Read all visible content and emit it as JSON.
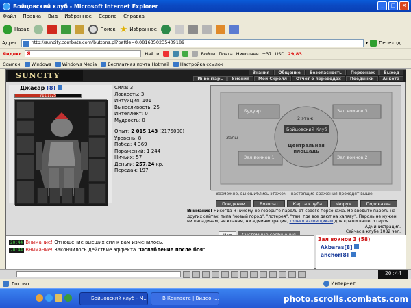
{
  "window": {
    "title": "Бойцовский клуб - Microsoft Internet Explorer"
  },
  "menu": [
    "Файл",
    "Правка",
    "Вид",
    "Избранное",
    "Сервис",
    "Справка"
  ],
  "toolbar": {
    "back": "Назад",
    "search": "Поиск",
    "favorites": "Избранное"
  },
  "address": {
    "label": "Адрес:",
    "url": "http://suncity.combats.com/buttons.pl?battle=0.0816350235409189",
    "go": "Переход"
  },
  "yandex": {
    "brand": "Яндекс",
    "query": "Я",
    "find": "Найти",
    "login": "Войти",
    "mail": "Почта",
    "user": "Николаев",
    "temp": "+37",
    "currency": "USD",
    "rate": "29,83"
  },
  "links": {
    "label": "Ссылки",
    "items": [
      "Windows",
      "Windows Media",
      "Бесплатная почта Hotmail",
      "Настройка ссылок"
    ]
  },
  "game": {
    "logo": "SUNCITY",
    "nav_top": [
      "Знания",
      "Общение",
      "Безопасность",
      "Персонаж",
      "Выход"
    ],
    "nav_bottom": [
      "Инвентарь",
      "Умения",
      "Мой Скролл",
      "Отчет о переводах",
      "Поединки",
      "Анкета"
    ],
    "character": {
      "name": "Джасар",
      "level": "[8]",
      "hp": "711/1125",
      "hp_fraction": 0.63
    },
    "stats": [
      "Сила: 3",
      "Ловкость: 3",
      "Интуиция: 101",
      "Выносливость: 25",
      "Интеллект: 0",
      "Мудрость: 0"
    ],
    "exp_label": "Опыт:",
    "exp_value": "2 015 143",
    "exp_next": "(2175000)",
    "details": [
      "Уровень: 8",
      "Побед: 4 369",
      "Поражений: 1 244",
      "Ничьих: 57"
    ],
    "money_label": "Деньги:",
    "money_value": "257.24",
    "money_unit": "кр.",
    "transfers": "Передач: 197",
    "map_labels": [
      "Будуар",
      "2 этаж",
      "Зал воинов 3",
      "Бойцовский Клуб",
      "Залы",
      "Центральная площадь",
      "Зал воинов 1",
      "Зал воинов 2"
    ],
    "map_note": "Возможно, вы ошиблись этажом - настоящие сражения проходят выше.",
    "map_buttons": [
      "Поединки",
      "Возврат",
      "Карта клуба",
      "Форум",
      "Подсказка"
    ],
    "warning_title": "Внимание!",
    "warning_text": "Никогда и никому не говорите пароль от своего персонажа. Не вводите пароль на других сайтах, типа \"новый город\", \"лотерея\", \"там, где все дают на халяву\". Пароль не нужен ни паладинам, ни кланам, ни администрации,",
    "warning_link": "только взломщикам",
    "warning_tail": "для кражи вашего героя.",
    "admin": "Администрация.",
    "online": "Сейчас в клубе 1082 чел.",
    "chat_tabs": [
      "Чат",
      "Системные сообщения"
    ],
    "chat": [
      {
        "time": "20:44",
        "alert": "Внимание!",
        "text": "Отношение высших сил к вам изменилось."
      },
      {
        "time": "20:44",
        "alert": "Внимание!",
        "text": "Закончилось действие эффекта",
        "bold": "\"Ослабление после боя\""
      }
    ],
    "room": {
      "title": "Зал воинов 3 (58)",
      "users": [
        "Akbaras[8]",
        "anchor[8]"
      ]
    },
    "clock": "20:44"
  },
  "status": {
    "done": "Готово",
    "zone": "Интернет"
  },
  "taskbar": {
    "items": [
      "Бойцовский клуб - M...",
      "В Контакте | Видео -..."
    ],
    "watermark": "photo.scrolls.combats.com"
  }
}
